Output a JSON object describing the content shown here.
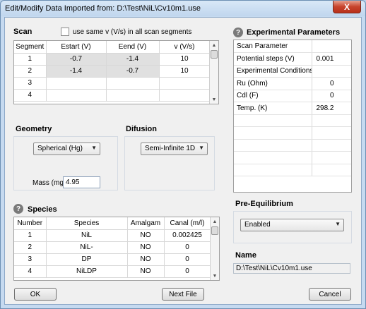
{
  "window": {
    "title": "Edit/Modify Data Imported from:  D:\\Test\\NiL\\Cv10m1.use",
    "close_label": "X"
  },
  "scan": {
    "title": "Scan",
    "same_v_label": "use same  v (V/s)  in all scan segments",
    "same_v_checked": false,
    "columns": [
      "Segment",
      "Estart (V)",
      "Eend (V)",
      "v (V/s)"
    ],
    "rows": [
      [
        "1",
        "-0.7",
        "-1.4",
        "10"
      ],
      [
        "2",
        "-1.4",
        "-0.7",
        "10"
      ],
      [
        "3",
        "",
        "",
        ""
      ],
      [
        "4",
        "",
        "",
        ""
      ]
    ]
  },
  "geometry": {
    "title": "Geometry",
    "selected": "Spherical (Hg)",
    "mass_label": "Mass (mg)",
    "mass_value": "4.95"
  },
  "diffusion": {
    "title": "Difusion",
    "selected": "Semi-Infinite 1D"
  },
  "species": {
    "title": "Species",
    "columns": [
      "Number",
      "Species",
      "Amalgam",
      "Canal (m/l)"
    ],
    "rows": [
      [
        "1",
        "NiL",
        "NO",
        "0.002425"
      ],
      [
        "2",
        "NiL-",
        "NO",
        "0"
      ],
      [
        "3",
        "DP",
        "NO",
        "0"
      ],
      [
        "4",
        "NiLDP",
        "NO",
        "0"
      ]
    ]
  },
  "experimental": {
    "title": "Experimental Parameters",
    "rows": [
      [
        "Scan Parameter",
        ""
      ],
      [
        "Potential steps (V)",
        "0.001"
      ],
      [
        "Experimental Conditions",
        ""
      ],
      [
        "Ru (Ohm)",
        "0"
      ],
      [
        "Cdl (F)",
        "0"
      ],
      [
        "Temp. (K)",
        "298.2"
      ]
    ]
  },
  "pre_equilibrium": {
    "title": "Pre-Equilibrium",
    "selected": "Enabled"
  },
  "name": {
    "title": "Name",
    "value": "D:\\Test\\NiL\\Cv10m1.use"
  },
  "buttons": {
    "ok": "OK",
    "next_file": "Next File",
    "cancel": "Cancel"
  },
  "icons": {
    "help": "?",
    "dropdown": "▼",
    "scroll_up": "▲",
    "scroll_down": "▼"
  }
}
